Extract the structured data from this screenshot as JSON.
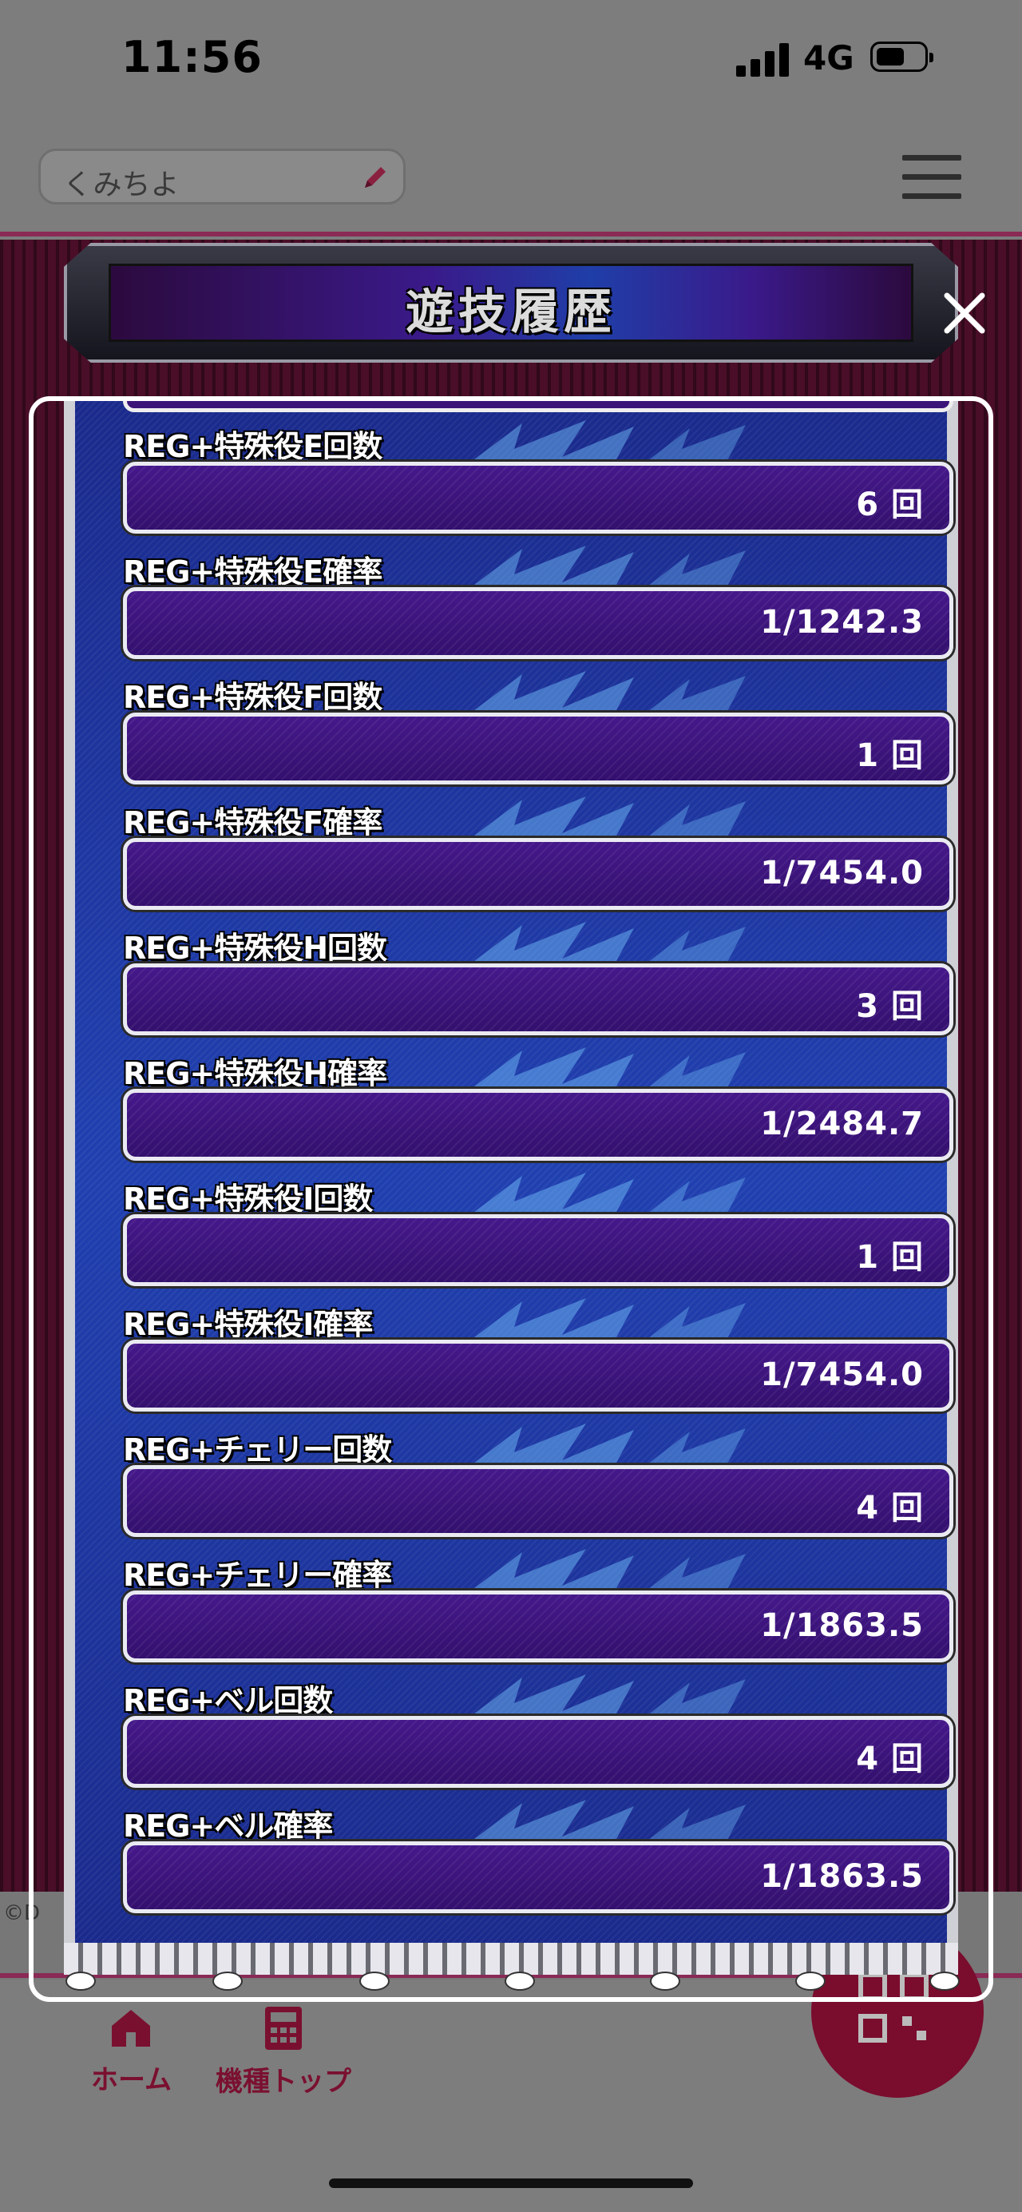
{
  "status_bar": {
    "time": "11:56",
    "network": "4G"
  },
  "header": {
    "user_name": "くみちよ"
  },
  "modal": {
    "title": "遊技履歴",
    "rows": [
      {
        "label": "REG+特殊役E回数",
        "value": "6 回"
      },
      {
        "label": "REG+特殊役E確率",
        "value": "1/1242.3"
      },
      {
        "label": "REG+特殊役F回数",
        "value": "1 回"
      },
      {
        "label": "REG+特殊役F確率",
        "value": "1/7454.0"
      },
      {
        "label": "REG+特殊役H回数",
        "value": "3 回"
      },
      {
        "label": "REG+特殊役H確率",
        "value": "1/2484.7"
      },
      {
        "label": "REG+特殊役Ⅰ回数",
        "value": "1 回"
      },
      {
        "label": "REG+特殊役Ⅰ確率",
        "value": "1/7454.0"
      },
      {
        "label": "REG+チェリー回数",
        "value": "4 回"
      },
      {
        "label": "REG+チェリー確率",
        "value": "1/1863.5"
      },
      {
        "label": "REG+ベル回数",
        "value": "4 回"
      },
      {
        "label": "REG+ベル確率",
        "value": "1/1863.5"
      }
    ]
  },
  "footer": {
    "copyright": "©D"
  },
  "bottom_nav": {
    "home_label": "ホーム",
    "model_top_label": "機種トップ"
  },
  "colors": {
    "accent": "#7a1030",
    "panel_blue": "#2040b0",
    "value_box_purple": "#3b1478"
  },
  "icons": [
    "signal-icon",
    "battery-icon",
    "pencil-icon",
    "menu-icon",
    "close-icon",
    "home-icon",
    "calculator-icon",
    "qr-code-icon"
  ]
}
